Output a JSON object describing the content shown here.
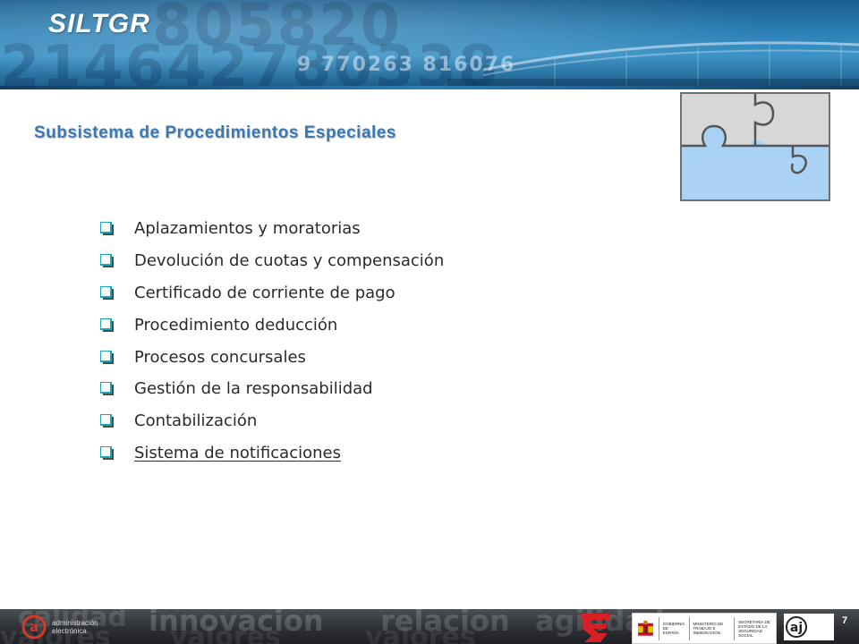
{
  "header": {
    "title": "SILTGR"
  },
  "subtitle": "Subsistema de Procedimientos Especiales",
  "items": [
    {
      "label": "Aplazamientos y moratorias"
    },
    {
      "label": "Devolución de cuotas y compensación"
    },
    {
      "label": "Certificado de corriente de pago"
    },
    {
      "label": "Procedimiento deducción"
    },
    {
      "label": "Procesos concursales"
    },
    {
      "label": "Gestión de la responsabilidad"
    },
    {
      "label": "Contabilización"
    },
    {
      "label": "Sistema de notificaciones"
    }
  ],
  "footer": {
    "page_number": "7",
    "background_words": [
      "calidad",
      "valores",
      "innovacion",
      "valores",
      "relacion",
      "valores",
      "agilidad"
    ]
  },
  "colors": {
    "header_blue": "#2a7fb5",
    "subtitle_blue": "#3a78b4",
    "bullet_teal": "#1aa6b4",
    "puzzle_gray": "#d5d5d5",
    "puzzle_blue": "#a8d1f5"
  },
  "icons": {
    "bullet": "checkbox-bullet-icon",
    "puzzle": "puzzle-icon"
  }
}
